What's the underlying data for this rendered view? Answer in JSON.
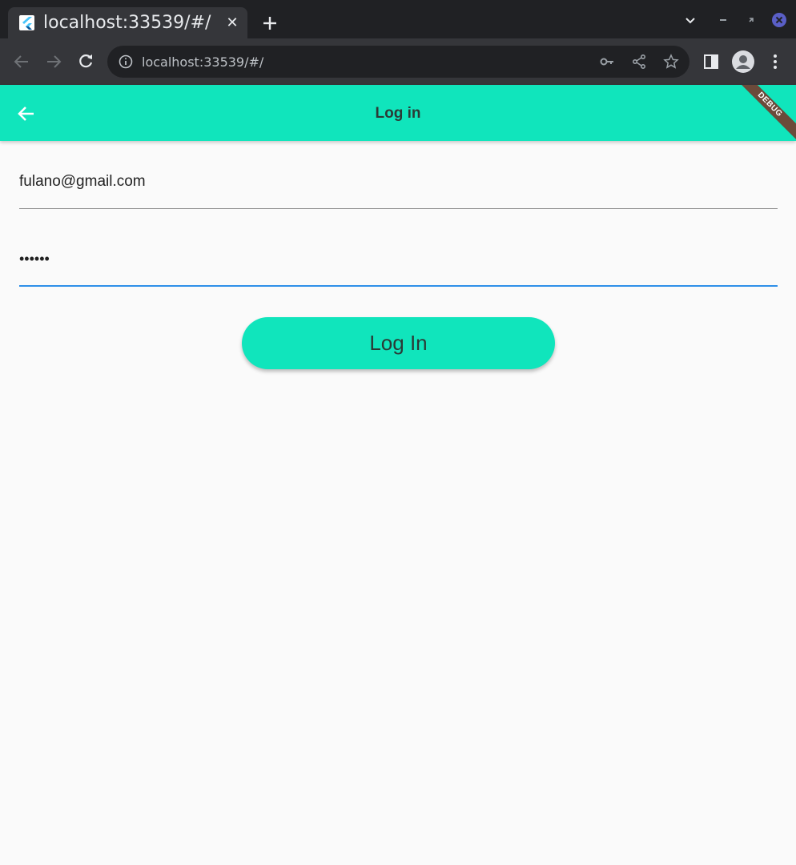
{
  "browser": {
    "tab_title": "localhost:33539/#/",
    "tab_close": "✕",
    "url": "localhost:33539/#/"
  },
  "app": {
    "title": "Log in",
    "debug_label": "DEBUG",
    "accent_color": "#10e5bc"
  },
  "form": {
    "email_value": "fulano@gmail.com",
    "password_value": "••••••",
    "login_label": "Log In"
  }
}
